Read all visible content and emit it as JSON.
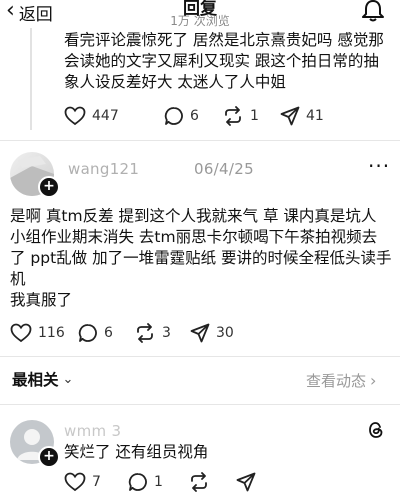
{
  "header": {
    "back_label": "返回",
    "title": "回复",
    "subtitle": "1万 次浏览",
    "back_icon": "chevron-left-icon",
    "bell_icon": "bell-icon"
  },
  "comment1": {
    "lines": [
      "看完评论震惊死了 居然是北京熹贵妃吗 感觉那",
      "会读她的文字又犀利又现实 跟这个拍日常的抽",
      "象人设反差好大 太迷人了人中姐"
    ],
    "likes": "447",
    "replies": "6",
    "reposts": "1",
    "shares": "41"
  },
  "comment2": {
    "username": "wang121",
    "date": "06/4/25",
    "lines": [
      "是啊 真tm反差 提到这个人我就来气 草 课内真是坑人",
      "小组作业期末消失 去tm丽思卡尔顿喝下午茶拍视频去",
      "了 ppt乱做 加了一堆雷霆贴纸 要讲的时候全程低头读手",
      "机",
      "我真服了"
    ],
    "likes": "116",
    "replies": "6",
    "reposts": "3",
    "shares": "30"
  },
  "sort": {
    "label": "最相关",
    "chevron": "chevron-down-icon",
    "view_activity": "查看动态"
  },
  "comment3": {
    "username": "wmm 3",
    "text": "笑烂了 还有组员视角",
    "likes": "7",
    "replies": "1"
  },
  "colors": {
    "text": "#111111",
    "muted": "#8a8a8a",
    "divider": "#e6e6e6"
  }
}
